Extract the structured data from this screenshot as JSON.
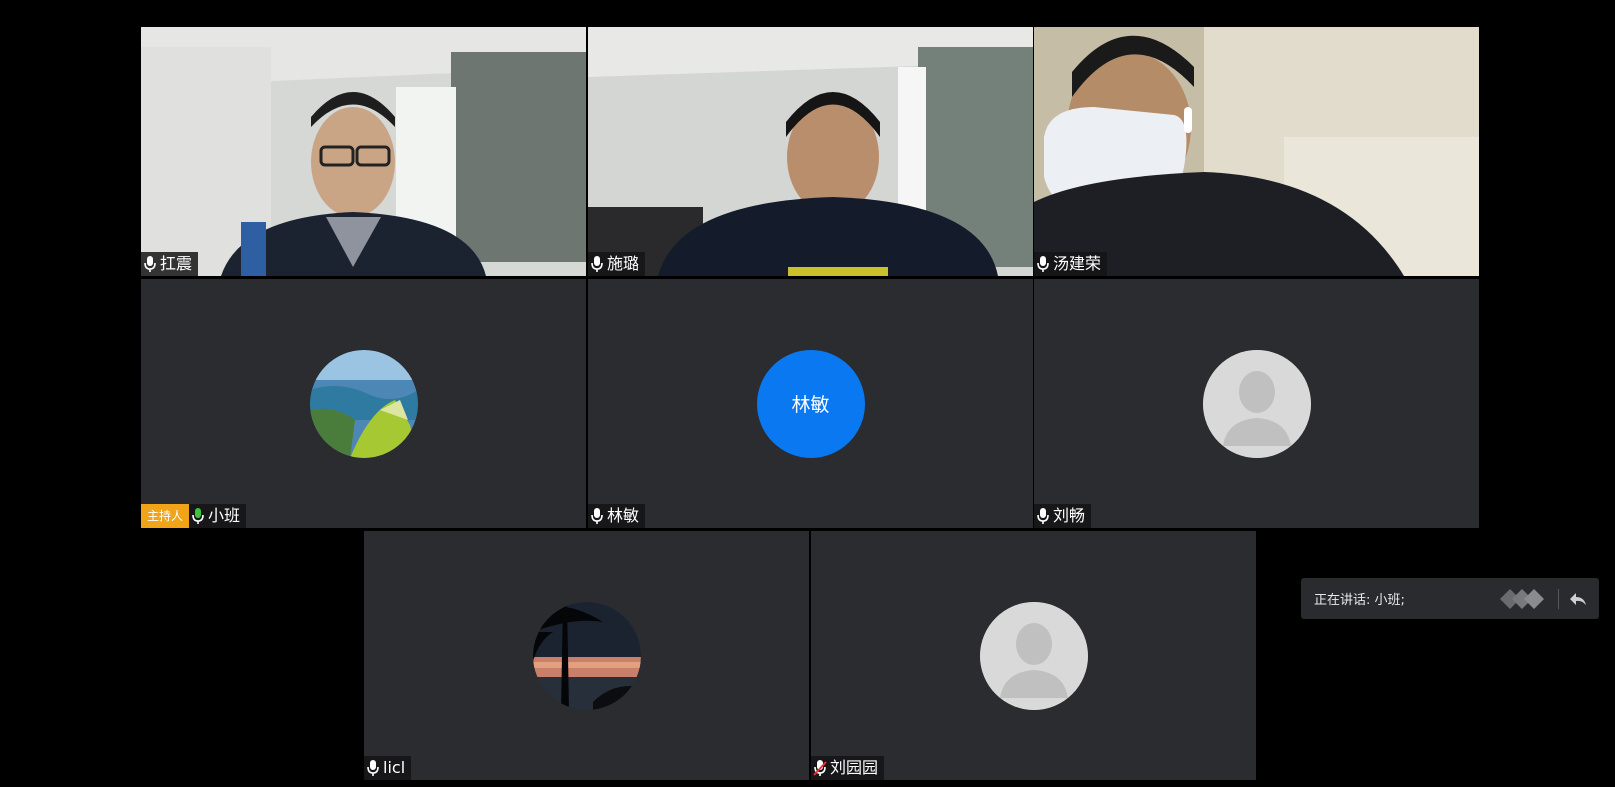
{
  "participants": [
    {
      "name": "扛震",
      "mic": "on",
      "type": "video"
    },
    {
      "name": "施璐",
      "mic": "on",
      "type": "video"
    },
    {
      "name": "汤建荣",
      "mic": "on",
      "type": "video"
    },
    {
      "name": "小班",
      "mic": "active",
      "type": "photo-avatar",
      "host_badge": "主持人"
    },
    {
      "name": "林敏",
      "mic": "on",
      "type": "initials-avatar",
      "initials": "林敏"
    },
    {
      "name": "刘畅",
      "mic": "on",
      "type": "default-avatar"
    },
    {
      "name": "licl",
      "mic": "on",
      "type": "photo-avatar"
    },
    {
      "name": "刘园园",
      "mic": "muted",
      "type": "default-avatar"
    }
  ],
  "speaking_panel": {
    "text": "正在讲话: 小班;"
  },
  "colors": {
    "host_badge": "#f2a419",
    "avatar_blue": "#0a78f0",
    "mic_active": "#3cc43c",
    "tile_bg": "#2b2c30"
  }
}
